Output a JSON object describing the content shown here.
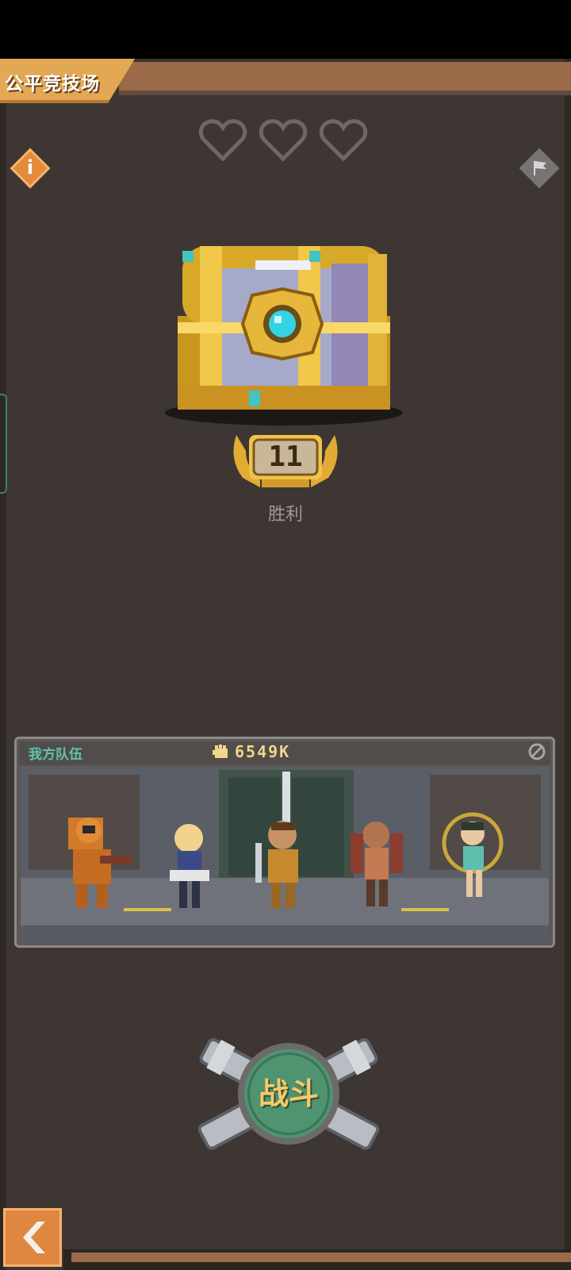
{
  "header": {
    "title": "公平竞技场"
  },
  "lives": {
    "hearts": [
      "heart-empty",
      "heart-empty",
      "heart-empty"
    ]
  },
  "buttons": {
    "info_glyph": "i",
    "flag_icon": "flag-icon",
    "back_icon": "chevron-left-icon"
  },
  "reward": {
    "wins": "11",
    "label": "胜利"
  },
  "team": {
    "title": "我方队伍",
    "power": "6549K"
  },
  "fight": {
    "label": "战斗"
  },
  "colors": {
    "background": "#3d3632",
    "accent_orange": "#e3a853",
    "team_title": "#5fc2ab",
    "fight_button": "#4f9371"
  }
}
